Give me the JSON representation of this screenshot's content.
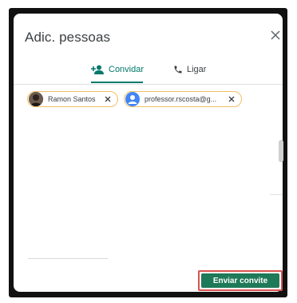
{
  "dialog": {
    "title": "Adic. pessoas",
    "close_icon": "close-icon"
  },
  "tabs": [
    {
      "label": "Convidar",
      "icon": "add-person-icon",
      "active": true
    },
    {
      "label": "Ligar",
      "icon": "phone-icon",
      "active": false
    }
  ],
  "chips": [
    {
      "label": "Ramon Santos",
      "avatar": "photo-avatar"
    },
    {
      "label": "professor.rscosta@g...",
      "avatar": "default-person-avatar"
    }
  ],
  "actions": {
    "send_label": "Enviar convite"
  },
  "colors": {
    "accent": "#00796b",
    "button": "#1f7a5a",
    "chip_border": "#f0c067",
    "highlight": "#d9534f",
    "avatar_blue": "#4285f4"
  }
}
